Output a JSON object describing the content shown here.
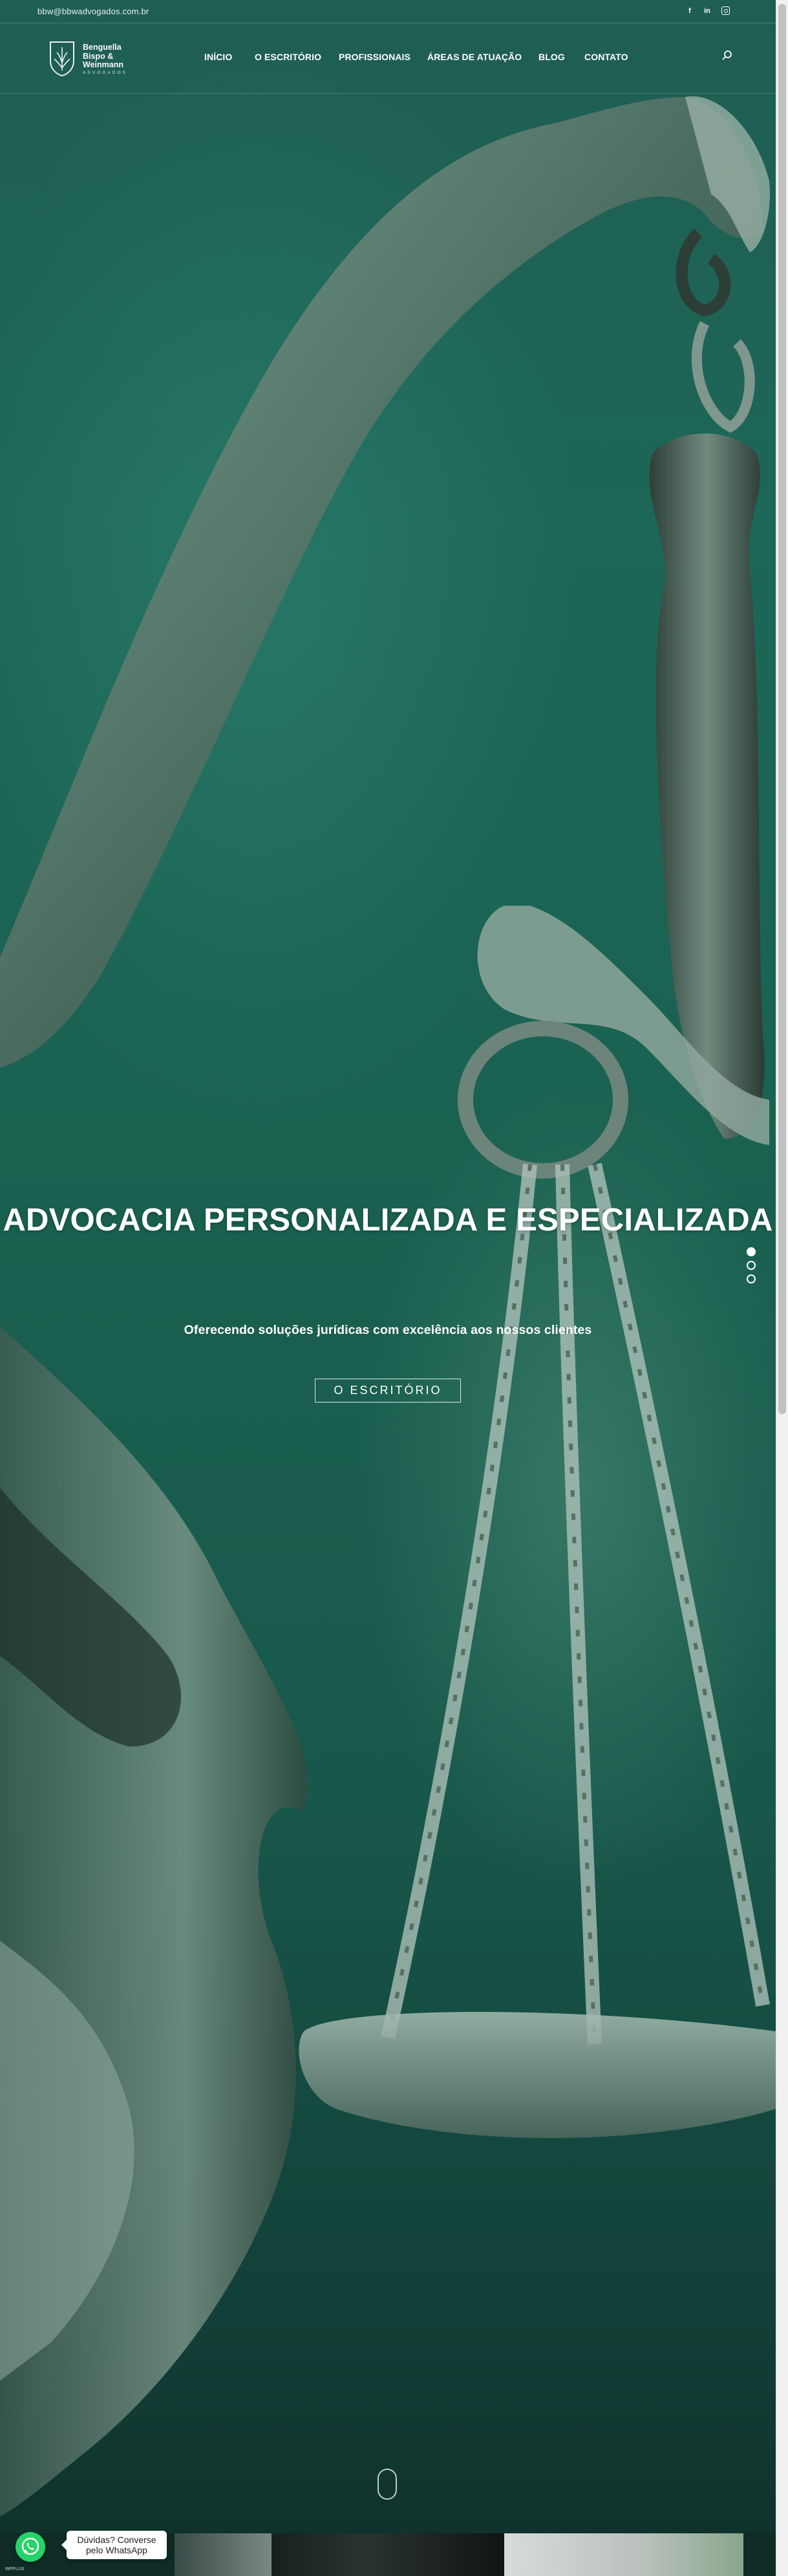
{
  "topbar": {
    "email": "bbw@bbwadvogados.com.br",
    "social": [
      {
        "icon": "facebook-icon",
        "glyph": "f"
      },
      {
        "icon": "linkedin-icon",
        "glyph": "in"
      },
      {
        "icon": "instagram-icon",
        "glyph": ""
      }
    ]
  },
  "logo": {
    "line1": "Benguella",
    "line2": "Bispo &",
    "line3": "Weinmann",
    "sub": "ADVOGADOS"
  },
  "nav": {
    "items": [
      {
        "label": "INÍCIO"
      },
      {
        "label": "O ESCRITÓRIO"
      },
      {
        "label": "PROFISSIONAIS"
      },
      {
        "label": "ÁREAS DE ATUAÇÃO"
      },
      {
        "label": "BLOG"
      },
      {
        "label": "CONTATO"
      }
    ],
    "search_icon": "search-icon"
  },
  "hero": {
    "title": "ADVOCACIA PERSONALIZADA E ESPECIALIZADA",
    "subtitle": "Oferecendo soluções jurídicas com excelência aos nossos clientes",
    "button_label": "O ESCRITÓRIO",
    "slides": 3,
    "active_slide": 1
  },
  "whatsapp": {
    "bubble_line1": "Dúvidas? Converse",
    "bubble_line2": "pelo WhatsApp",
    "credit": "WPPLUS"
  },
  "colors": {
    "hero_green": "#1d6757",
    "text": "#ffffff",
    "whatsapp": "#25d366"
  }
}
